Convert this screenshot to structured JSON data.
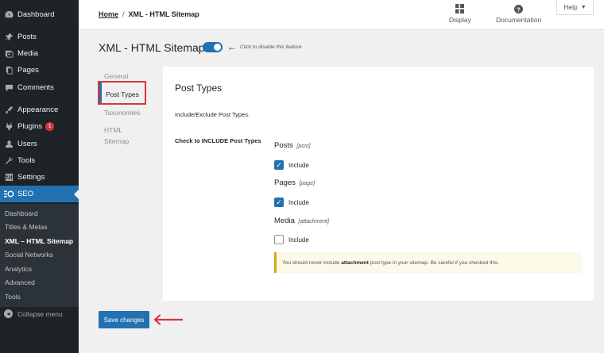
{
  "sidebar": {
    "items": [
      {
        "label": "Dashboard",
        "icon": "dashboard-icon"
      },
      {
        "label": "Posts",
        "icon": "pushpin-icon"
      },
      {
        "label": "Media",
        "icon": "media-icon"
      },
      {
        "label": "Pages",
        "icon": "pages-icon"
      },
      {
        "label": "Comments",
        "icon": "comments-icon"
      },
      {
        "label": "Appearance",
        "icon": "appearance-icon"
      },
      {
        "label": "Plugins",
        "icon": "plugins-icon",
        "badge": "1"
      },
      {
        "label": "Users",
        "icon": "users-icon"
      },
      {
        "label": "Tools",
        "icon": "tools-icon"
      },
      {
        "label": "Settings",
        "icon": "settings-icon"
      },
      {
        "label": "SEO",
        "icon": "seo-icon"
      }
    ],
    "submenu": [
      "Dashboard",
      "Titles & Metas",
      "XML – HTML Sitemap",
      "Social Networks",
      "Analytics",
      "Advanced",
      "Tools"
    ],
    "collapse_label": "Collapse menu"
  },
  "header": {
    "breadcrumb_home": "Home",
    "breadcrumb_sep": "/",
    "breadcrumb_current": "XML - HTML Sitemap",
    "display_label": "Display",
    "documentation_label": "Documentation",
    "help_label": "Help"
  },
  "page": {
    "title": "XML - HTML Sitemap",
    "toggle_hint": "Click to disable this feature",
    "toggle_on": true
  },
  "tabs": {
    "general": "General",
    "post_types": "Post Types",
    "taxonomies": "Taxonomies",
    "html_line1": "HTML",
    "html_line2": "Sitemap"
  },
  "card": {
    "title": "Post Types",
    "description": "Include/Exclude Post Types.",
    "field_label": "Check to INCLUDE Post Types",
    "post_types": [
      {
        "name": "Posts",
        "slug": "[post]",
        "checkbox_label": "Include",
        "checked": true
      },
      {
        "name": "Pages",
        "slug": "[page]",
        "checkbox_label": "Include",
        "checked": true
      },
      {
        "name": "Media",
        "slug": "[attachment]",
        "checkbox_label": "Include",
        "checked": false
      }
    ],
    "notice_before": "You should never include",
    "notice_bold": "attachment",
    "notice_after": "post type in your sitemap. Be careful if you checked this."
  },
  "save_label": "Save changes",
  "colors": {
    "accent": "#2271b1",
    "sidebar_bg": "#1d2327",
    "highlight_red": "#d63638",
    "notice_border": "#dba617"
  }
}
